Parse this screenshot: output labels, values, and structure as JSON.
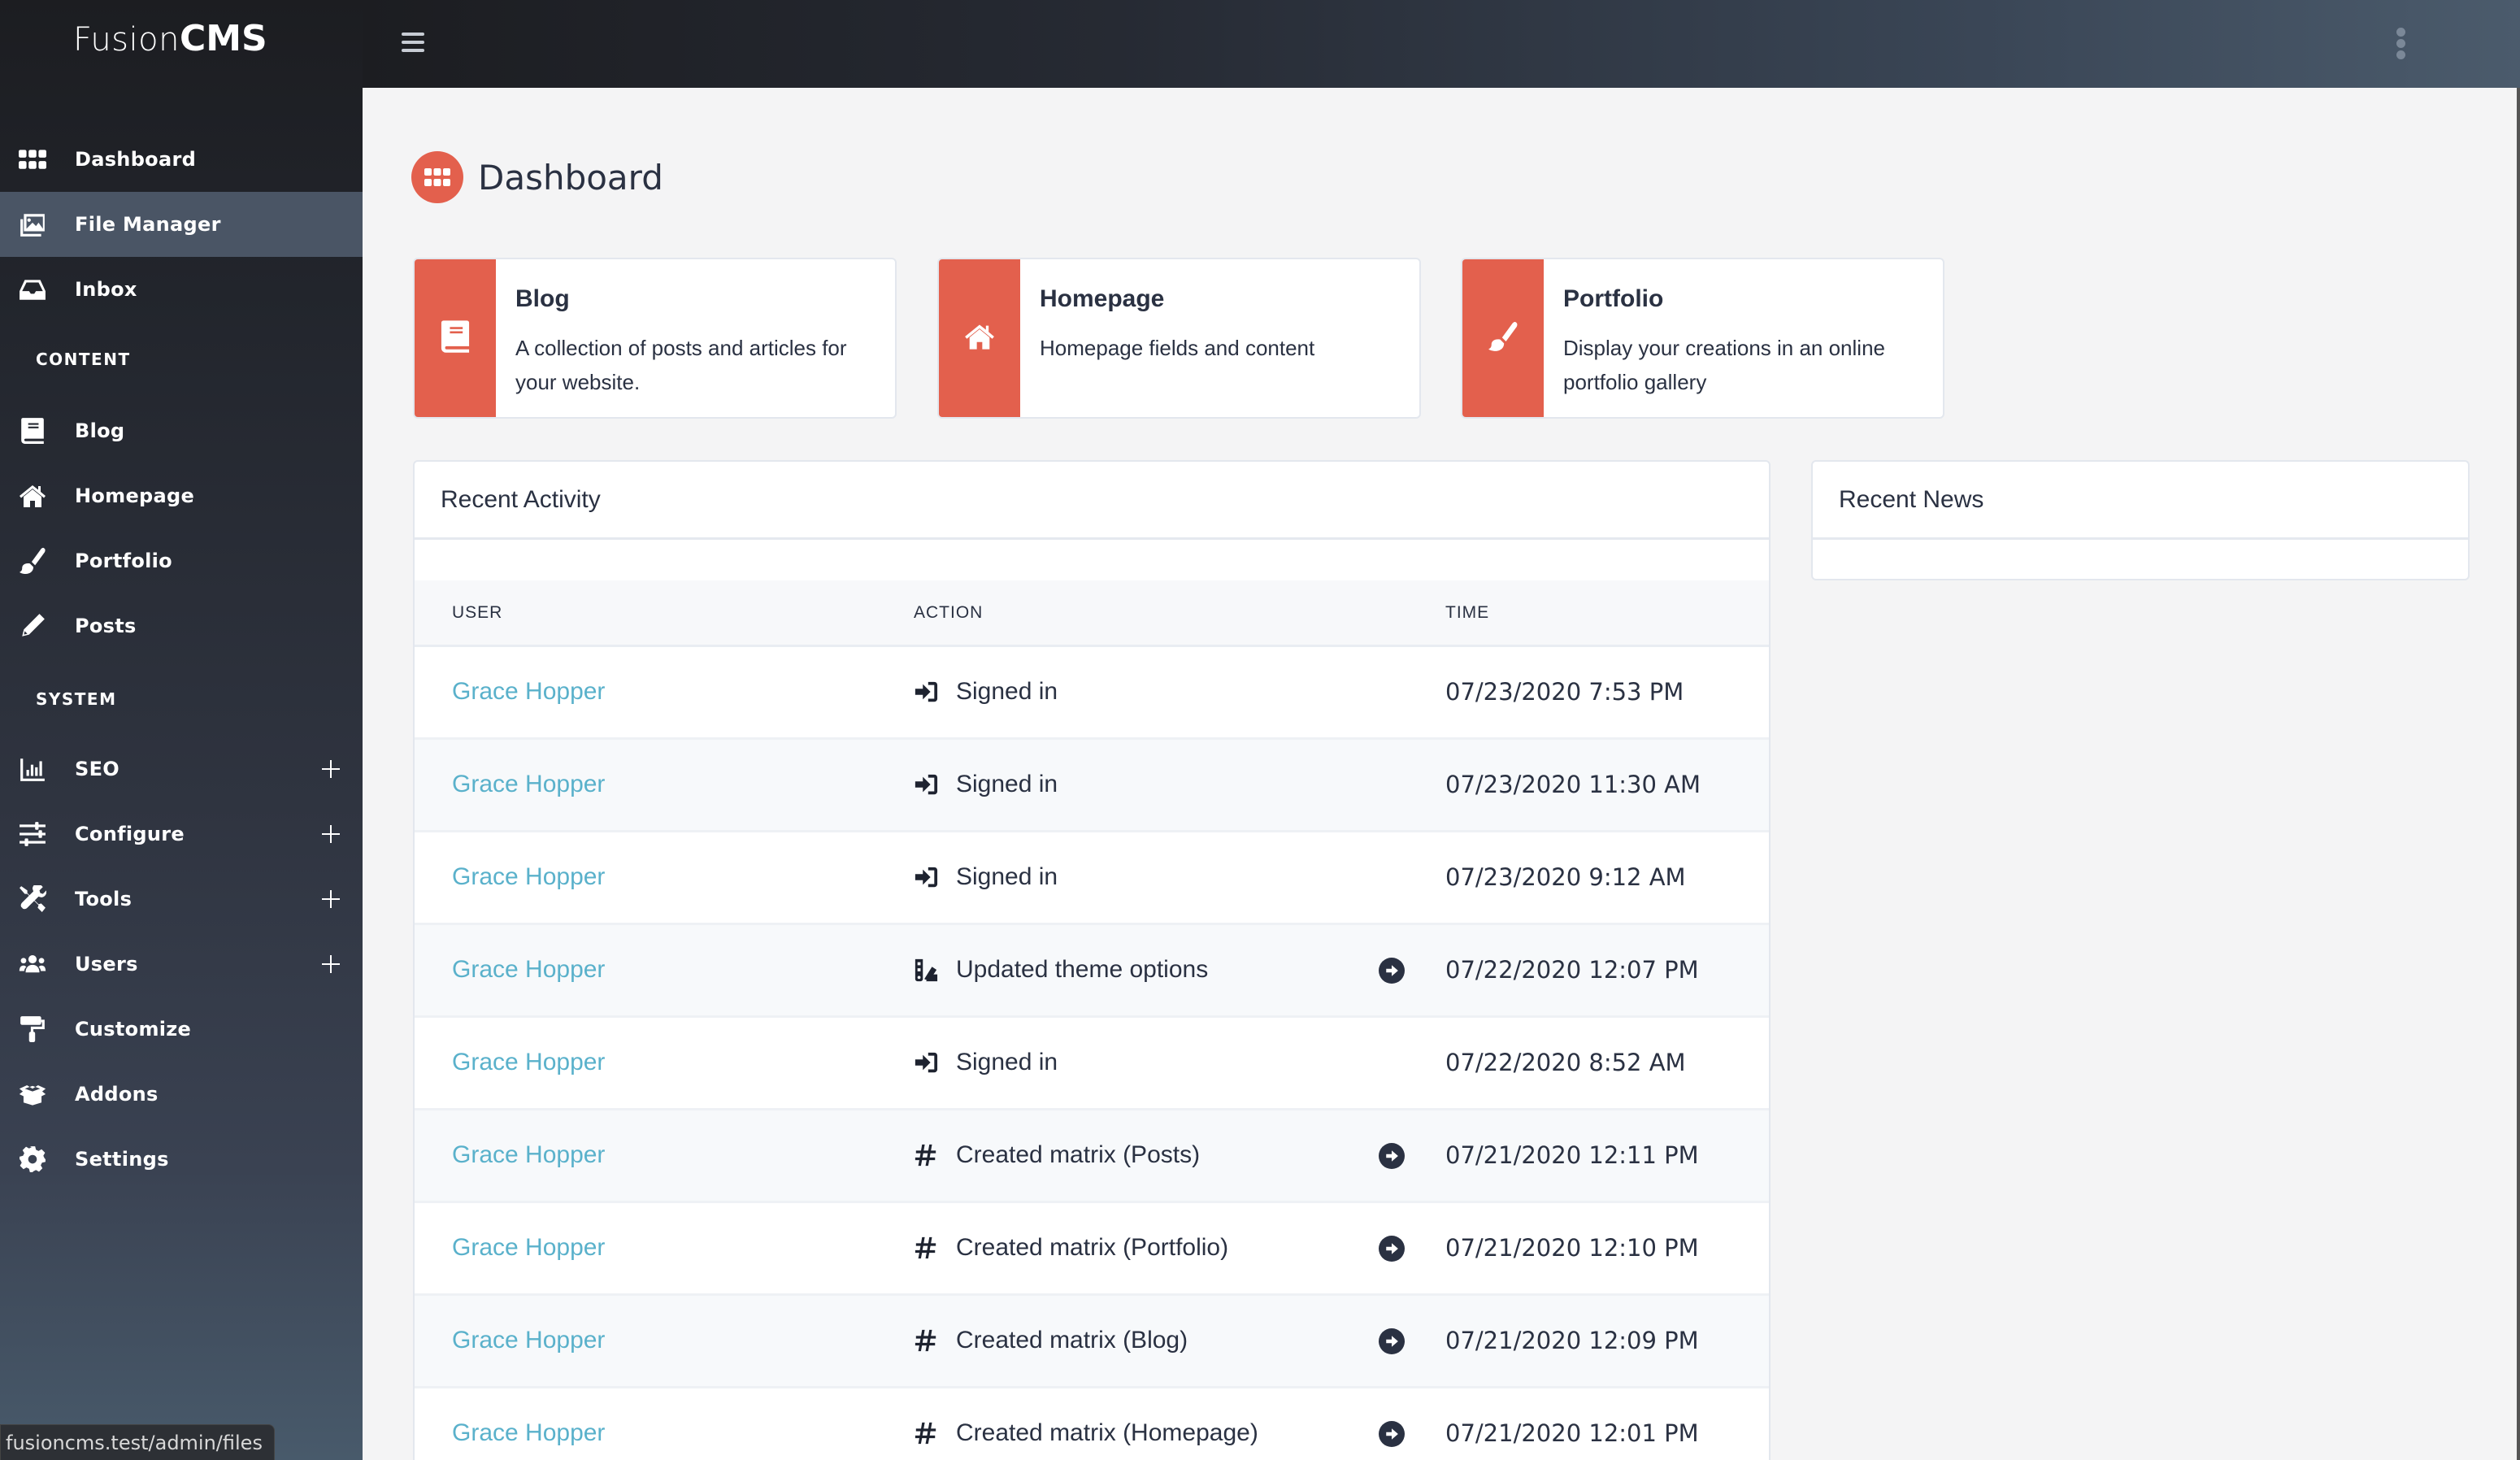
{
  "app": {
    "logo_light": "Fusion",
    "logo_bold": "CMS"
  },
  "sidebar": {
    "items": [
      {
        "label": "Dashboard",
        "icon": "grid-icon",
        "active": false
      },
      {
        "label": "File Manager",
        "icon": "images-icon",
        "active": true
      },
      {
        "label": "Inbox",
        "icon": "inbox-icon",
        "active": false
      }
    ],
    "content_section": "CONTENT",
    "content_items": [
      {
        "label": "Blog",
        "icon": "book-icon"
      },
      {
        "label": "Homepage",
        "icon": "home-icon"
      },
      {
        "label": "Portfolio",
        "icon": "paint-brush-icon"
      },
      {
        "label": "Posts",
        "icon": "pencil-icon"
      }
    ],
    "system_section": "SYSTEM",
    "system_items": [
      {
        "label": "SEO",
        "icon": "chart-bar-icon",
        "expandable": true
      },
      {
        "label": "Configure",
        "icon": "sliders-icon",
        "expandable": true
      },
      {
        "label": "Tools",
        "icon": "tools-icon",
        "expandable": true
      },
      {
        "label": "Users",
        "icon": "users-icon",
        "expandable": true
      },
      {
        "label": "Customize",
        "icon": "paint-roller-icon",
        "expandable": false
      },
      {
        "label": "Addons",
        "icon": "box-open-icon",
        "expandable": false
      },
      {
        "label": "Settings",
        "icon": "cog-icon",
        "expandable": false
      }
    ]
  },
  "page": {
    "title": "Dashboard",
    "title_icon": "grid-icon"
  },
  "quick_links": [
    {
      "title": "Blog",
      "description": "A collection of posts and articles for your website.",
      "icon": "book-icon"
    },
    {
      "title": "Homepage",
      "description": "Homepage fields and content",
      "icon": "home-icon"
    },
    {
      "title": "Portfolio",
      "description": "Display your creations in an online portfolio gallery",
      "icon": "paint-brush-icon"
    }
  ],
  "recent_activity": {
    "title": "Recent Activity",
    "columns": [
      "USER",
      "ACTION",
      "TIME"
    ],
    "rows": [
      {
        "user": "Grace Hopper",
        "icon": "sign-in-icon",
        "action": "Signed in",
        "link": false,
        "time": "07/23/2020 7:53 PM"
      },
      {
        "user": "Grace Hopper",
        "icon": "sign-in-icon",
        "action": "Signed in",
        "link": false,
        "time": "07/23/2020 11:30 AM"
      },
      {
        "user": "Grace Hopper",
        "icon": "sign-in-icon",
        "action": "Signed in",
        "link": false,
        "time": "07/23/2020 9:12 AM"
      },
      {
        "user": "Grace Hopper",
        "icon": "swatchbook-icon",
        "action": "Updated theme options",
        "link": true,
        "time": "07/22/2020 12:07 PM"
      },
      {
        "user": "Grace Hopper",
        "icon": "sign-in-icon",
        "action": "Signed in",
        "link": false,
        "time": "07/22/2020 8:52 AM"
      },
      {
        "user": "Grace Hopper",
        "icon": "hashtag-icon",
        "action": "Created matrix (Posts)",
        "link": true,
        "time": "07/21/2020 12:11 PM"
      },
      {
        "user": "Grace Hopper",
        "icon": "hashtag-icon",
        "action": "Created matrix (Portfolio)",
        "link": true,
        "time": "07/21/2020 12:10 PM"
      },
      {
        "user": "Grace Hopper",
        "icon": "hashtag-icon",
        "action": "Created matrix (Blog)",
        "link": true,
        "time": "07/21/2020 12:09 PM"
      },
      {
        "user": "Grace Hopper",
        "icon": "hashtag-icon",
        "action": "Created matrix (Homepage)",
        "link": true,
        "time": "07/21/2020 12:01 PM"
      }
    ]
  },
  "recent_news": {
    "title": "Recent News"
  },
  "status_bar": {
    "url": "fusioncms.test/admin/files"
  },
  "colors": {
    "accent": "#e3604d",
    "link": "#5ab1cb",
    "text": "#2a3142",
    "sidebar_active": "#4a5565"
  }
}
